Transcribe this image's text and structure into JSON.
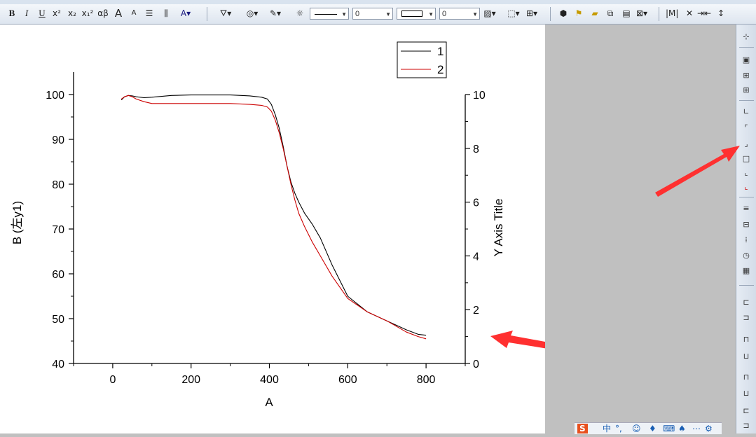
{
  "toolbar": {
    "bold": "B",
    "italic": "I",
    "underline": "U",
    "superscript": "x²",
    "subscript": "x₂",
    "supsub": "x₁²",
    "greek": "αβ",
    "increase_font": "A",
    "decrease_font": "A",
    "line_width_value": "0",
    "border_width_value": "0"
  },
  "chart_data": {
    "type": "line",
    "xlabel": "A",
    "ylabel": "B (左y1)",
    "y2label": "Y Axis Title",
    "xlim": [
      -100,
      900
    ],
    "ylim": [
      40,
      105
    ],
    "y2lim": [
      0,
      10
    ],
    "x_ticks": [
      0,
      200,
      400,
      600,
      800
    ],
    "y_ticks": [
      40,
      50,
      60,
      70,
      80,
      90,
      100
    ],
    "y2_ticks": [
      0,
      2,
      4,
      6,
      8,
      10
    ],
    "legend_position": "top-right",
    "series": [
      {
        "name": "1",
        "color": "#000000",
        "x": [
          22,
          30,
          40,
          50,
          60,
          80,
          100,
          150,
          200,
          250,
          300,
          350,
          380,
          395,
          405,
          415,
          425,
          435,
          445,
          455,
          465,
          475,
          490,
          510,
          530,
          560,
          600,
          650,
          700,
          750,
          780,
          800
        ],
        "y": [
          98.8,
          99.5,
          99.8,
          99.7,
          99.5,
          99.3,
          99.4,
          99.8,
          99.9,
          99.9,
          99.9,
          99.7,
          99.4,
          99.0,
          97.8,
          95.5,
          92.5,
          88.5,
          84.0,
          80.5,
          78.0,
          76.0,
          73.5,
          71.0,
          68.0,
          62.0,
          55.0,
          51.5,
          49.5,
          47.5,
          46.5,
          46.3
        ]
      },
      {
        "name": "2",
        "color": "#cc0000",
        "x": [
          22,
          30,
          40,
          50,
          60,
          80,
          100,
          150,
          200,
          250,
          300,
          350,
          380,
          395,
          405,
          415,
          425,
          435,
          445,
          455,
          465,
          475,
          490,
          510,
          530,
          560,
          600,
          650,
          700,
          750,
          780,
          800
        ],
        "y": [
          99.0,
          99.5,
          99.8,
          99.5,
          99.0,
          98.4,
          98.0,
          98.0,
          98.0,
          98.0,
          98.0,
          97.8,
          97.6,
          97.2,
          96.3,
          94.3,
          91.5,
          88.0,
          84.0,
          80.0,
          76.5,
          73.5,
          70.5,
          67.0,
          64.0,
          59.5,
          54.5,
          51.5,
          49.5,
          47.0,
          46.0,
          45.5
        ]
      }
    ]
  },
  "taskbar": {
    "ime_label": "中"
  }
}
